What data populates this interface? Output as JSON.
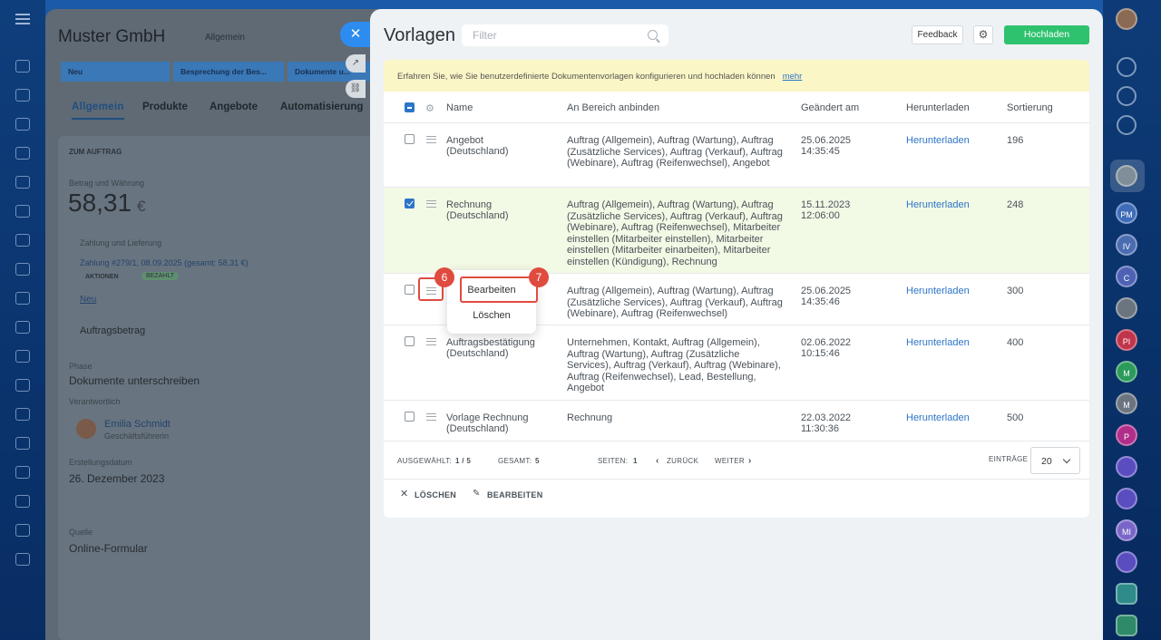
{
  "background": {
    "title": "Muster GmbH",
    "subtitle": "Allgemein",
    "stages": [
      "Neu",
      "Besprechung der Bes...",
      "Dokumente u..."
    ],
    "tabs": [
      "Allgemein",
      "Produkte",
      "Angebote",
      "Automatisierung"
    ],
    "section": "ZUM AUFTRAG",
    "amount_label": "Betrag und Währung",
    "amount": "58,31",
    "currency": "€",
    "payment_label": "Zahlung und Lieferung",
    "payment": "Zahlung #279/1, 08.09.2025 (gesamt: 58,31 €)",
    "actions": "AKTIONEN",
    "paid": "BEZAHLT",
    "new_link": "Neu",
    "order_amount": "Auftragsbetrag",
    "phase_label": "Phase",
    "phase": "Dokumente unterschreiben",
    "responsible_label": "Verantwortlich",
    "person": "Emilia Schmidt",
    "person_role": "Geschäftsführerin",
    "date_label": "Erstellungsdatum",
    "date": "26. Dezember 2023",
    "source_label": "Quelle",
    "source": "Online-Formular"
  },
  "panel": {
    "title": "Vorlagen",
    "filter_placeholder": "Filter",
    "feedback": "Feedback",
    "upload": "Hochladen",
    "notice": "Erfahren Sie, wie Sie benutzerdefinierte Dokumentenvorlagen konfigurieren und hochladen können",
    "notice_link": "mehr",
    "columns": {
      "name": "Name",
      "bind": "An Bereich anbinden",
      "changed": "Geändert am",
      "download": "Herunterladen",
      "sort": "Sortierung"
    },
    "rows": [
      {
        "name1": "Angebot",
        "name2": "(Deutschland)",
        "bind": "Auftrag (Allgemein), Auftrag (Wartung), Auftrag (Zusätzliche Services), Auftrag (Verkauf), Auftrag (Webinare), Auftrag (Reifenwechsel), Angebot",
        "date1": "25.06.2025",
        "date2": "14:35:45",
        "dl": "Herunterladen",
        "sort": "196"
      },
      {
        "name1": "Rechnung",
        "name2": "(Deutschland)",
        "bind": "Auftrag (Allgemein), Auftrag (Wartung), Auftrag (Zusätzliche Services), Auftrag (Verkauf), Auftrag (Webinare), Auftrag (Reifenwechsel), Mitarbeiter einstellen (Mitarbeiter einstellen), Mitarbeiter einstellen (Mitarbeiter einarbeiten), Mitarbeiter einstellen (Kündigung), Rechnung",
        "date1": "15.11.2023",
        "date2": "12:06:00",
        "dl": "Herunterladen",
        "sort": "248"
      },
      {
        "name1": "",
        "name2": "",
        "bind": "Auftrag (Allgemein), Auftrag (Wartung), Auftrag (Zusätzliche Services), Auftrag (Verkauf), Auftrag (Webinare), Auftrag (Reifenwechsel)",
        "date1": "25.06.2025",
        "date2": "14:35:46",
        "dl": "Herunterladen",
        "sort": "300"
      },
      {
        "name1": "Auftragsbestätigung",
        "name2": "(Deutschland)",
        "bind": "Unternehmen, Kontakt, Auftrag (Allgemein), Auftrag (Wartung), Auftrag (Zusätzliche Services), Auftrag (Verkauf), Auftrag (Webinare), Auftrag (Reifenwechsel), Lead, Bestellung, Angebot",
        "date1": "02.06.2022",
        "date2": "10:15:46",
        "dl": "Herunterladen",
        "sort": "400"
      },
      {
        "name1": "Vorlage Rechnung",
        "name2": "(Deutschland)",
        "bind": "Rechnung",
        "date1": "22.03.2022",
        "date2": "11:30:36",
        "dl": "Herunterladen",
        "sort": "500"
      }
    ],
    "footer": {
      "selected_label": "AUSGEWÄHLT:",
      "selected": "1 / 5",
      "total_label": "GESAMT:",
      "total": "5",
      "pages_label": "SEITEN:",
      "pages": "1",
      "back": "ZURÜCK",
      "next": "WEITER",
      "entries_label": "EINTRÄGE",
      "entries": "20"
    },
    "actions": {
      "delete": "LÖSCHEN",
      "edit": "BEARBEITEN"
    },
    "menu": {
      "edit": "Bearbeiten",
      "delete": "Löschen"
    },
    "badges": [
      "6",
      "7"
    ]
  },
  "rail_avatars": [
    "PM",
    "IV",
    "C",
    "PI",
    "M",
    "M",
    "P",
    "MI"
  ]
}
